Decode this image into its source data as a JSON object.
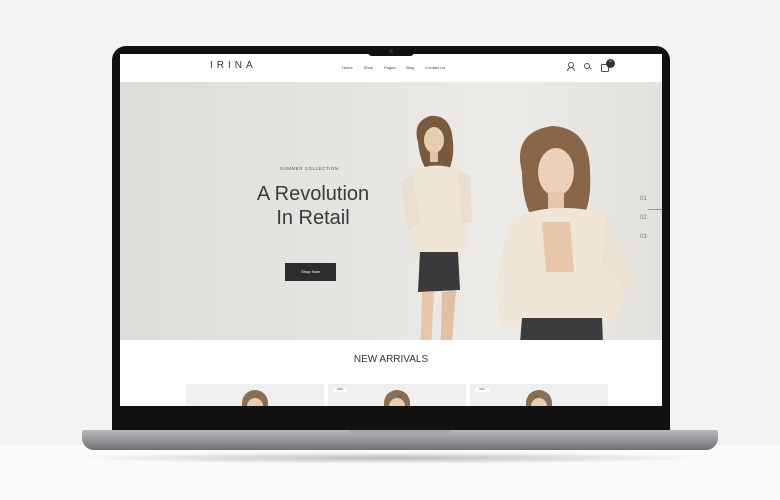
{
  "site": {
    "logo": "IRINA",
    "nav": [
      "Home",
      "Shop",
      "Pages",
      "Blog",
      "Contact Us"
    ],
    "cart_count": "0"
  },
  "hero": {
    "subtitle": "SUMMER COLLECTION",
    "title_line1": "A Revolution",
    "title_line2": "In Retail",
    "button": "Shop Now",
    "slides": [
      "01",
      "02",
      "03"
    ]
  },
  "arrivals": {
    "title": "NEW ARRIVALS",
    "tag": "NEW"
  },
  "colors": {
    "accent": "#2d2d2d",
    "hero_bg": "#e6e4e1",
    "text": "#3a3a3a"
  }
}
